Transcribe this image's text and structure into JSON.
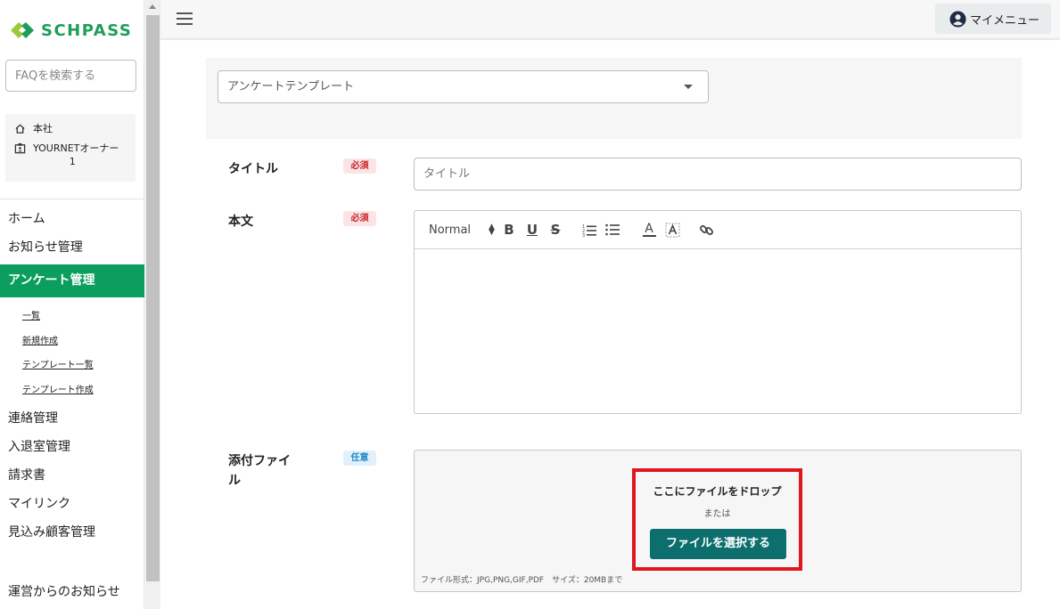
{
  "brand": {
    "logo_text": "SCHPASS",
    "color": "#1e9e5a"
  },
  "search": {
    "placeholder": "FAQを検索する"
  },
  "org": {
    "company": "本社",
    "user_name": "YOURNETオーナー",
    "user_num": "1"
  },
  "nav": {
    "home": "ホーム",
    "notice": "お知らせ管理",
    "survey": "アンケート管理",
    "survey_sub": [
      "一覧",
      "新規作成",
      "テンプレート一覧",
      "テンプレート作成"
    ],
    "contact": "連絡管理",
    "entry": "入退室管理",
    "invoice": "請求書",
    "mylink": "マイリンク",
    "prospect": "見込み顧客管理",
    "ops_notice": "運営からのお知らせ",
    "active_color": "#0b9e5e"
  },
  "header": {
    "mymenu": "マイメニュー"
  },
  "form": {
    "template_placeholder": "アンケートテンプレート",
    "title_label": "タイトル",
    "title_placeholder": "タイトル",
    "body_label": "本文",
    "attach_label_line1": "添付ファイ",
    "attach_label_line2": "ル",
    "required": "必須",
    "optional": "任意",
    "editor": {
      "format": "Normal",
      "bold": "B",
      "underline": "U",
      "strike": "S",
      "color_a": "A"
    },
    "drop_text": "ここにファイルをドロップ",
    "or_text": "または",
    "select_button": "ファイルを選択する",
    "file_note": "ファイル形式：JPG,PNG,GIF,PDF　サイズ：20MBまで",
    "button_color": "#0d6e6e",
    "highlight_color": "#e0161e"
  }
}
